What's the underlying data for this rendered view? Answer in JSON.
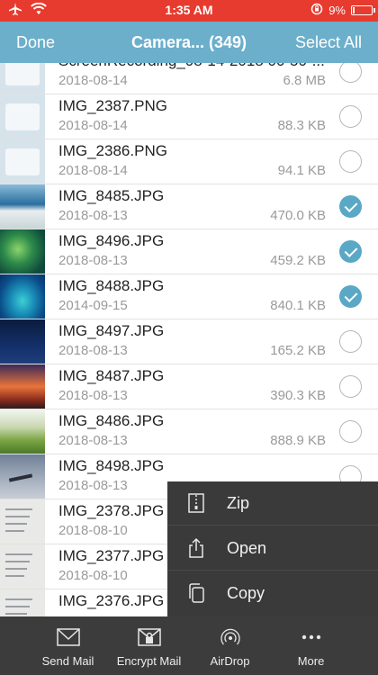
{
  "status_bar": {
    "time": "1:35 AM",
    "battery": "9%",
    "battery_level": 0.09,
    "color": "#e63b2e"
  },
  "nav": {
    "left": "Done",
    "title": "Camera... (349)",
    "right": "Select All",
    "color": "#6cafcb"
  },
  "files": [
    {
      "name": "ScreenRecording_08-14-2018 00-50-...",
      "date": "2018-08-14",
      "size": "6.8 MB",
      "selected": false,
      "thumb": "screenshot"
    },
    {
      "name": "IMG_2387.PNG",
      "date": "2018-08-14",
      "size": "88.3 KB",
      "selected": false,
      "thumb": "screenshot"
    },
    {
      "name": "IMG_2386.PNG",
      "date": "2018-08-14",
      "size": "94.1 KB",
      "selected": false,
      "thumb": "screenshot"
    },
    {
      "name": "IMG_8485.JPG",
      "date": "2018-08-13",
      "size": "470.0 KB",
      "selected": true,
      "thumb": "ocean"
    },
    {
      "name": "IMG_8496.JPG",
      "date": "2018-08-13",
      "size": "459.2 KB",
      "selected": true,
      "thumb": "green-island"
    },
    {
      "name": "IMG_8488.JPG",
      "date": "2014-09-15",
      "size": "840.1 KB",
      "selected": true,
      "thumb": "lagoon"
    },
    {
      "name": "IMG_8497.JPG",
      "date": "2018-08-13",
      "size": "165.2 KB",
      "selected": false,
      "thumb": "dark-sky"
    },
    {
      "name": "IMG_8487.JPG",
      "date": "2018-08-13",
      "size": "390.3 KB",
      "selected": false,
      "thumb": "sunset"
    },
    {
      "name": "IMG_8486.JPG",
      "date": "2018-08-13",
      "size": "888.9 KB",
      "selected": false,
      "thumb": "field"
    },
    {
      "name": "IMG_8498.JPG",
      "date": "2018-08-13",
      "size": "",
      "selected": false,
      "thumb": "airplane"
    },
    {
      "name": "IMG_2378.JPG",
      "date": "2018-08-10",
      "size": "",
      "selected": false,
      "thumb": "document"
    },
    {
      "name": "IMG_2377.JPG",
      "date": "2018-08-10",
      "size": "",
      "selected": false,
      "thumb": "document"
    },
    {
      "name": "IMG_2376.JPG",
      "date": "",
      "size": "",
      "selected": false,
      "thumb": "document"
    }
  ],
  "context_menu": [
    {
      "label": "Zip",
      "icon": "zip-icon"
    },
    {
      "label": "Open",
      "icon": "share-icon"
    },
    {
      "label": "Copy",
      "icon": "copy-icon"
    }
  ],
  "toolbar": [
    {
      "label": "Send Mail",
      "icon": "envelope-icon"
    },
    {
      "label": "Encrypt Mail",
      "icon": "encrypted-envelope-icon"
    },
    {
      "label": "AirDrop",
      "icon": "airdrop-icon"
    },
    {
      "label": "More",
      "icon": "more-dots-icon"
    }
  ],
  "colors": {
    "accent": "#5aa8c6",
    "toolbar_bg": "#3c3c3c",
    "menu_bg": "#3a3a3a"
  }
}
